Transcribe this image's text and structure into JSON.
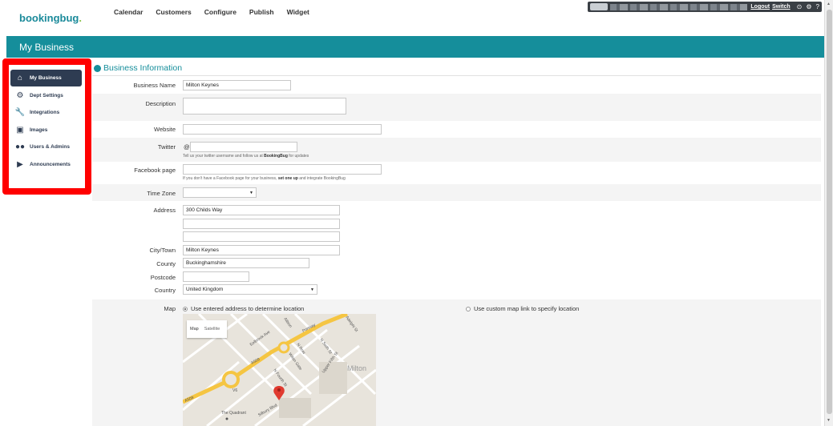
{
  "brand": {
    "name": "bookingbug",
    "dot": "."
  },
  "nav": [
    "Calendar",
    "Customers",
    "Configure",
    "Publish",
    "Widget"
  ],
  "userbar": {
    "switch_label": "Switch",
    "logout_label": "Logout",
    "switch_link": "Switch"
  },
  "page_title": "My Business",
  "sidebar": {
    "items": [
      {
        "label": "My Business",
        "icon": "home-icon",
        "active": true
      },
      {
        "label": "Dept Settings",
        "icon": "gear-icon",
        "active": false
      },
      {
        "label": "Integrations",
        "icon": "wrench-icon",
        "active": false
      },
      {
        "label": "Images",
        "icon": "image-icon",
        "active": false
      },
      {
        "label": "Users & Admins",
        "icon": "users-icon",
        "active": false
      },
      {
        "label": "Announcements",
        "icon": "megaphone-icon",
        "active": false
      }
    ]
  },
  "section": {
    "title": "Business Information"
  },
  "form": {
    "business_name": {
      "label": "Business Name",
      "value": "Milton Keynes"
    },
    "description": {
      "label": "Description",
      "value": ""
    },
    "website": {
      "label": "Website",
      "value": ""
    },
    "twitter": {
      "label": "Twitter",
      "prefix": "@",
      "value": "",
      "help_pre": "Tell us your twitter username and follow us at ",
      "help_bold": "BookingBug",
      "help_post": " for updates"
    },
    "facebook": {
      "label": "Facebook page",
      "value": "",
      "help_pre": "If you don't have a Facebook page for your business, ",
      "help_bold": "set one up",
      "help_post": " and integrate BookingBug"
    },
    "time_zone": {
      "label": "Time Zone",
      "value": ""
    },
    "address": {
      "label": "Address",
      "line1": "300 Childs Way",
      "line2": "",
      "line3": ""
    },
    "city": {
      "label": "City/Town",
      "value": "Milton Keynes"
    },
    "county": {
      "label": "County",
      "value": "Buckinghamshire"
    },
    "postcode": {
      "label": "Postcode",
      "value": ""
    },
    "country": {
      "label": "Country",
      "value": "United Kingdom"
    },
    "map": {
      "label": "Map",
      "option_address": "Use entered address to determine location",
      "option_custom": "Use custom map link to specify location",
      "tab_map": "Map",
      "tab_satellite": "Satellite",
      "place_labels": {
        "city": "Milton",
        "road_a509": "A509",
        "road_a509_lower": "A509",
        "portway": "Portway",
        "eelbrook": "Eelbrook Ave",
        "witan": "Witan Gate",
        "n_row": "N Row",
        "n_fourth": "N Fourth St",
        "n_sixth": "N Sixth St",
        "upper_fifth": "Upper Fifth St",
        "silbury": "Silbury Blvd",
        "quadrant": "The Quadrant",
        "v6": "V6",
        "albion": "Albion",
        "adelphi": "Adelphi St"
      }
    }
  },
  "colors": {
    "brand": "#158e9b",
    "sidebar_active": "#2e3c52",
    "highlight": "#ff0000",
    "pin": "#e03a2f"
  }
}
